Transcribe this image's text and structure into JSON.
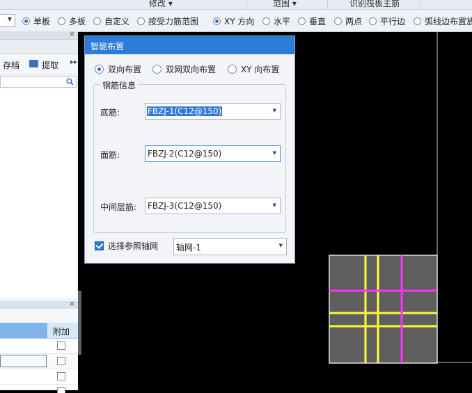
{
  "top_strip": {
    "modify": "修改 ▾",
    "range": "范围 ▾",
    "recognize": "识别筏板主筋"
  },
  "option_bar": {
    "options": [
      {
        "label": "单板",
        "selected": true
      },
      {
        "label": "多板",
        "selected": false
      },
      {
        "label": "自定义",
        "selected": false
      },
      {
        "label": "按受力筋范围",
        "selected": false
      },
      {
        "label": "XY 方向",
        "selected": true
      },
      {
        "label": "水平",
        "selected": false
      },
      {
        "label": "垂直",
        "selected": false
      },
      {
        "label": "两点",
        "selected": false
      },
      {
        "label": "平行边",
        "selected": false
      },
      {
        "label": "弧线边布置放",
        "selected": false
      }
    ]
  },
  "left_panel": {
    "tools": {
      "save": "存档",
      "extract": "提取"
    },
    "lower_table": {
      "header": "附加"
    }
  },
  "dialog": {
    "title": "智能布置",
    "modes": [
      {
        "label": "双向布置",
        "selected": true
      },
      {
        "label": "双网双向布置",
        "selected": false
      },
      {
        "label": "XY 向布置",
        "selected": false
      }
    ],
    "group_title": "钢筋信息",
    "fields": [
      {
        "label": "底筋:",
        "value": "FBZJ-1(C12@150)"
      },
      {
        "label": "面筋:",
        "value": "FBZJ-2(C12@150)"
      },
      {
        "label": "中间层筋:",
        "value": "FBZJ-3(C12@150)"
      }
    ],
    "ref_axis": {
      "label": "选择参照轴网",
      "checked": true,
      "value": "轴网-1"
    }
  },
  "colors": {
    "title_bar": "#2c7dd9",
    "slab": "#5e5e5e",
    "x_rebar": "#ffff33",
    "y_rebar": "#ff33ff"
  }
}
